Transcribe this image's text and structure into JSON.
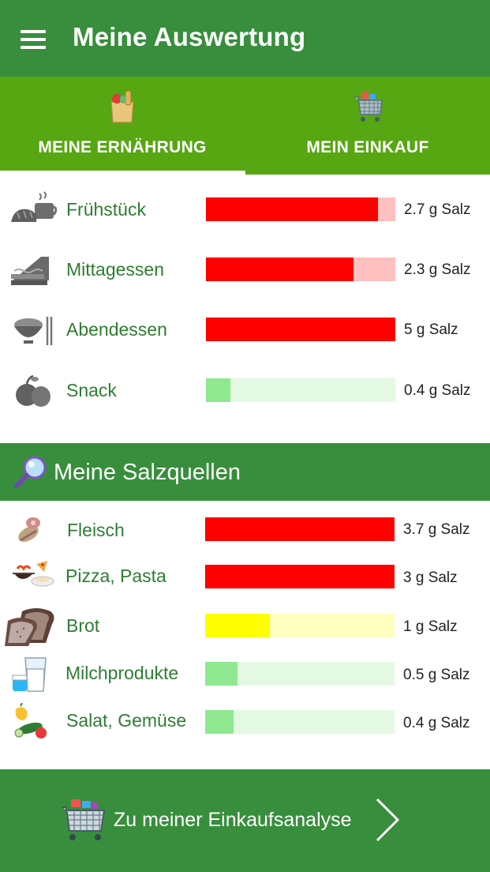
{
  "appbar": {
    "title": "Meine Auswertung"
  },
  "tabs": [
    {
      "label": "MEINE ERNÄHRUNG",
      "icon": "grocery-bag-icon",
      "selected": true
    },
    {
      "label": "MEIN EINKAUF",
      "icon": "shopping-cart-icon",
      "selected": false
    }
  ],
  "meals": [
    {
      "label": "Frühstück",
      "value": "2.7 g Salz",
      "level": 0.91,
      "color": "#ff0000",
      "track": "#ffc0c0",
      "icon": "breakfast-icon"
    },
    {
      "label": "Mittagessen",
      "value": "2.3 g Salz",
      "level": 0.78,
      "color": "#ff0000",
      "track": "#ffc0c0",
      "icon": "sandwich-icon"
    },
    {
      "label": "Abendessen",
      "value": "5 g Salz",
      "level": 1.0,
      "color": "#ff0000",
      "track": "#ffc0c0",
      "icon": "dinner-bowl-icon"
    },
    {
      "label": "Snack",
      "value": "0.4 g Salz",
      "level": 0.13,
      "color": "#90e890",
      "track": "#e4f9e4",
      "icon": "apple-icon"
    }
  ],
  "sources_section": {
    "title": "Meine Salzquellen",
    "icon": "magnifier-icon"
  },
  "sources": [
    {
      "label": "Fleisch",
      "value": "3.7 g Salz",
      "level": 1.0,
      "color": "#ff0000",
      "track": "#ffc0c0",
      "icon": "meat-icon"
    },
    {
      "label": "Pizza, Pasta",
      "value": "3 g Salz",
      "level": 1.0,
      "color": "#ff0000",
      "track": "#ffc0c0",
      "icon": "pizza-pasta-icon"
    },
    {
      "label": "Brot",
      "value": "1 g Salz",
      "level": 0.34,
      "color": "#ffff00",
      "track": "#ffffc0",
      "icon": "bread-icon"
    },
    {
      "label": "Milchprodukte",
      "value": "0.5 g Salz",
      "level": 0.17,
      "color": "#90e890",
      "track": "#e4f9e4",
      "icon": "milk-icon"
    },
    {
      "label": "Salat, Gemüse",
      "value": "0.4 g Salz",
      "level": 0.15,
      "color": "#90e890",
      "track": "#e4f9e4",
      "icon": "vegetables-icon"
    }
  ],
  "cta": {
    "label": "Zu meiner Einkaufsanalyse",
    "icon": "shopping-cart-icon"
  },
  "colors": {
    "appbar": "#388e3c",
    "tabs": "#56a712",
    "label_green": "#2e7d32"
  }
}
